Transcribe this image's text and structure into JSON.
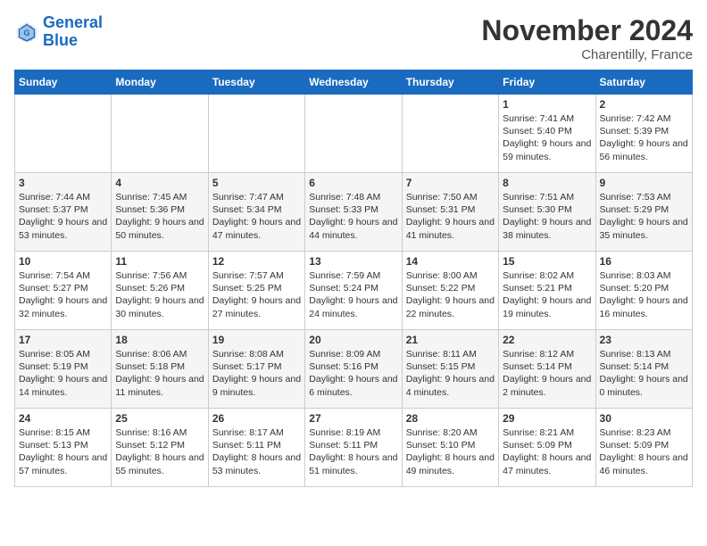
{
  "header": {
    "logo_line1": "General",
    "logo_line2": "Blue",
    "month": "November 2024",
    "location": "Charentilly, France"
  },
  "weekdays": [
    "Sunday",
    "Monday",
    "Tuesday",
    "Wednesday",
    "Thursday",
    "Friday",
    "Saturday"
  ],
  "weeks": [
    [
      {
        "day": "",
        "text": ""
      },
      {
        "day": "",
        "text": ""
      },
      {
        "day": "",
        "text": ""
      },
      {
        "day": "",
        "text": ""
      },
      {
        "day": "",
        "text": ""
      },
      {
        "day": "1",
        "text": "Sunrise: 7:41 AM\nSunset: 5:40 PM\nDaylight: 9 hours and 59 minutes."
      },
      {
        "day": "2",
        "text": "Sunrise: 7:42 AM\nSunset: 5:39 PM\nDaylight: 9 hours and 56 minutes."
      }
    ],
    [
      {
        "day": "3",
        "text": "Sunrise: 7:44 AM\nSunset: 5:37 PM\nDaylight: 9 hours and 53 minutes."
      },
      {
        "day": "4",
        "text": "Sunrise: 7:45 AM\nSunset: 5:36 PM\nDaylight: 9 hours and 50 minutes."
      },
      {
        "day": "5",
        "text": "Sunrise: 7:47 AM\nSunset: 5:34 PM\nDaylight: 9 hours and 47 minutes."
      },
      {
        "day": "6",
        "text": "Sunrise: 7:48 AM\nSunset: 5:33 PM\nDaylight: 9 hours and 44 minutes."
      },
      {
        "day": "7",
        "text": "Sunrise: 7:50 AM\nSunset: 5:31 PM\nDaylight: 9 hours and 41 minutes."
      },
      {
        "day": "8",
        "text": "Sunrise: 7:51 AM\nSunset: 5:30 PM\nDaylight: 9 hours and 38 minutes."
      },
      {
        "day": "9",
        "text": "Sunrise: 7:53 AM\nSunset: 5:29 PM\nDaylight: 9 hours and 35 minutes."
      }
    ],
    [
      {
        "day": "10",
        "text": "Sunrise: 7:54 AM\nSunset: 5:27 PM\nDaylight: 9 hours and 32 minutes."
      },
      {
        "day": "11",
        "text": "Sunrise: 7:56 AM\nSunset: 5:26 PM\nDaylight: 9 hours and 30 minutes."
      },
      {
        "day": "12",
        "text": "Sunrise: 7:57 AM\nSunset: 5:25 PM\nDaylight: 9 hours and 27 minutes."
      },
      {
        "day": "13",
        "text": "Sunrise: 7:59 AM\nSunset: 5:24 PM\nDaylight: 9 hours and 24 minutes."
      },
      {
        "day": "14",
        "text": "Sunrise: 8:00 AM\nSunset: 5:22 PM\nDaylight: 9 hours and 22 minutes."
      },
      {
        "day": "15",
        "text": "Sunrise: 8:02 AM\nSunset: 5:21 PM\nDaylight: 9 hours and 19 minutes."
      },
      {
        "day": "16",
        "text": "Sunrise: 8:03 AM\nSunset: 5:20 PM\nDaylight: 9 hours and 16 minutes."
      }
    ],
    [
      {
        "day": "17",
        "text": "Sunrise: 8:05 AM\nSunset: 5:19 PM\nDaylight: 9 hours and 14 minutes."
      },
      {
        "day": "18",
        "text": "Sunrise: 8:06 AM\nSunset: 5:18 PM\nDaylight: 9 hours and 11 minutes."
      },
      {
        "day": "19",
        "text": "Sunrise: 8:08 AM\nSunset: 5:17 PM\nDaylight: 9 hours and 9 minutes."
      },
      {
        "day": "20",
        "text": "Sunrise: 8:09 AM\nSunset: 5:16 PM\nDaylight: 9 hours and 6 minutes."
      },
      {
        "day": "21",
        "text": "Sunrise: 8:11 AM\nSunset: 5:15 PM\nDaylight: 9 hours and 4 minutes."
      },
      {
        "day": "22",
        "text": "Sunrise: 8:12 AM\nSunset: 5:14 PM\nDaylight: 9 hours and 2 minutes."
      },
      {
        "day": "23",
        "text": "Sunrise: 8:13 AM\nSunset: 5:14 PM\nDaylight: 9 hours and 0 minutes."
      }
    ],
    [
      {
        "day": "24",
        "text": "Sunrise: 8:15 AM\nSunset: 5:13 PM\nDaylight: 8 hours and 57 minutes."
      },
      {
        "day": "25",
        "text": "Sunrise: 8:16 AM\nSunset: 5:12 PM\nDaylight: 8 hours and 55 minutes."
      },
      {
        "day": "26",
        "text": "Sunrise: 8:17 AM\nSunset: 5:11 PM\nDaylight: 8 hours and 53 minutes."
      },
      {
        "day": "27",
        "text": "Sunrise: 8:19 AM\nSunset: 5:11 PM\nDaylight: 8 hours and 51 minutes."
      },
      {
        "day": "28",
        "text": "Sunrise: 8:20 AM\nSunset: 5:10 PM\nDaylight: 8 hours and 49 minutes."
      },
      {
        "day": "29",
        "text": "Sunrise: 8:21 AM\nSunset: 5:09 PM\nDaylight: 8 hours and 47 minutes."
      },
      {
        "day": "30",
        "text": "Sunrise: 8:23 AM\nSunset: 5:09 PM\nDaylight: 8 hours and 46 minutes."
      }
    ]
  ]
}
